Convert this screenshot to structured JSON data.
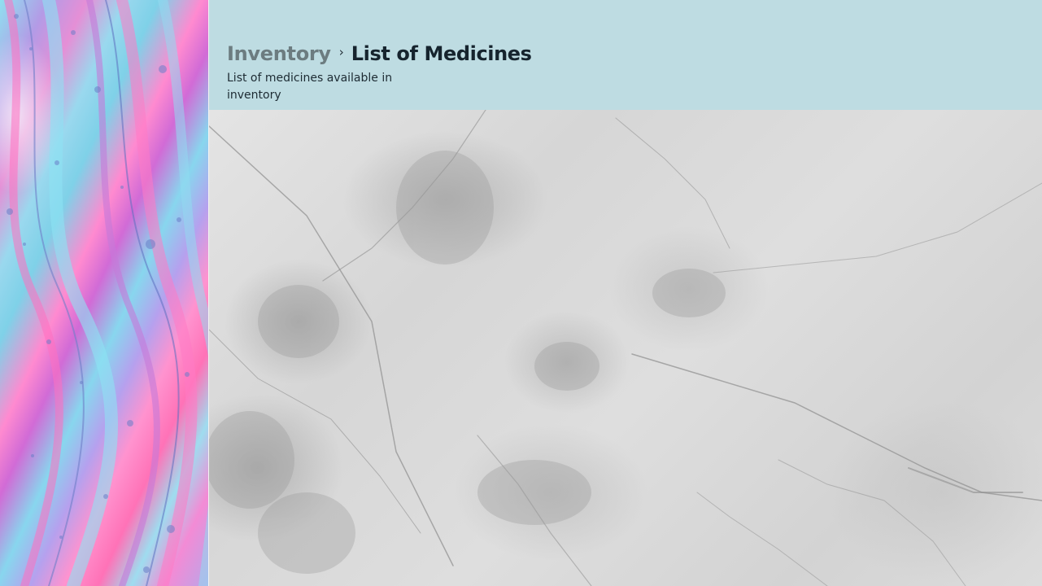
{
  "header": {
    "breadcrumb": {
      "parent": "Inventory",
      "separator": "›",
      "current": "List of Medicines"
    },
    "subtitle": "List of medicines available in inventory"
  },
  "colors": {
    "header_background": "#bedce2",
    "breadcrumb_parent": "#6c7c80",
    "breadcrumb_current": "#16242e",
    "subtitle_text": "#1d2b33"
  },
  "icons": {
    "breadcrumb_separator": "chevron-right-icon"
  }
}
